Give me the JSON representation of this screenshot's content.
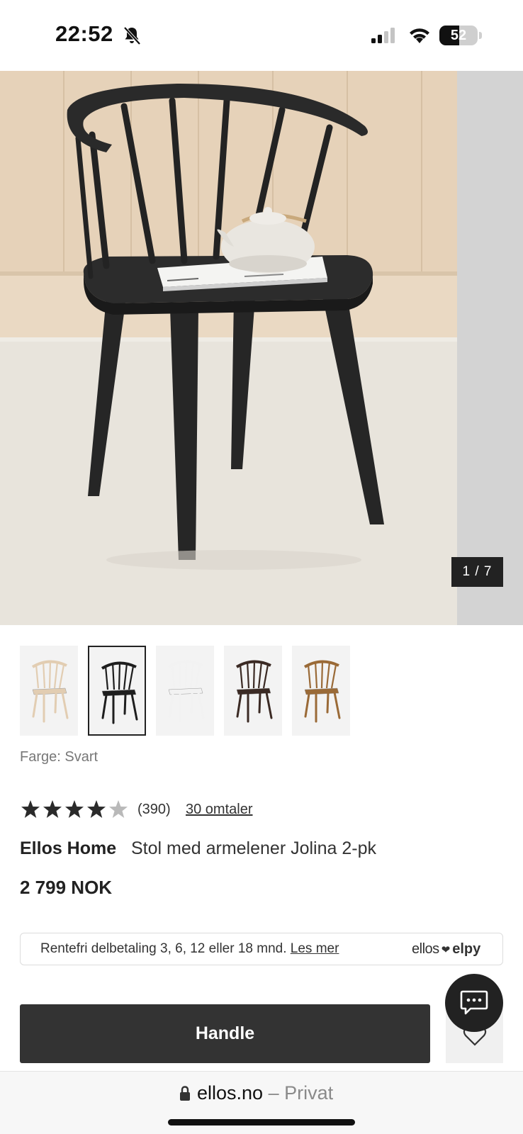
{
  "status_bar": {
    "time": "22:52",
    "battery_level": "52",
    "battery_fraction": 0.52,
    "icons": [
      "bell-slash-icon",
      "cellular-signal-icon",
      "wifi-icon",
      "battery-icon"
    ]
  },
  "product": {
    "image_counter": "1 / 7",
    "color_label": "Farge: Svart",
    "rating": 4,
    "rating_max": 5,
    "rating_count": "(390)",
    "reviews_link": "30 omtaler",
    "brand": "Ellos Home",
    "name": "Stol med armelener Jolina 2-pk",
    "price": "2 799 NOK",
    "thumbnails": [
      {
        "color_hex": "#e2cdb2",
        "selected": false
      },
      {
        "color_hex": "#1e1e1e",
        "selected": true
      },
      {
        "color_hex": "#f2f2f2",
        "selected": false
      },
      {
        "color_hex": "#3b2a24",
        "selected": false
      },
      {
        "color_hex": "#9a6a37",
        "selected": false
      }
    ]
  },
  "financing": {
    "text": "Rentefri delbetaling 3, 6, 12 eller 18 mnd.",
    "link": "Les mer",
    "logo_ellos": "ellos",
    "logo_elpy": "elpy"
  },
  "actions": {
    "buy_label": "Handle"
  },
  "browser": {
    "domain": "ellos.no",
    "separator": "–",
    "mode": "Privat"
  },
  "colors": {
    "button_dark": "#333333",
    "chat_bubble": "#222222",
    "counter_bg": "#222222"
  }
}
